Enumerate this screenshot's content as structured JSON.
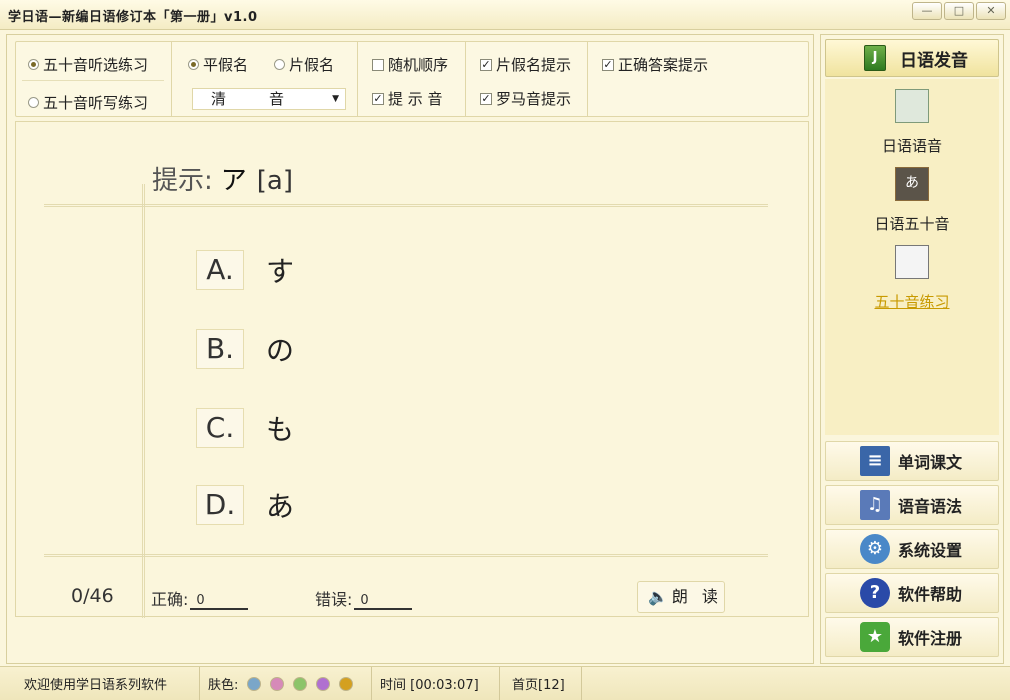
{
  "window": {
    "title": "学日语—新编日语修订本「第一册」v1.0"
  },
  "options": {
    "mode_choice": "五十音听选练习",
    "mode_write": "五十音听写练习",
    "hiragana": "平假名",
    "katakana": "片假名",
    "sound_type": "清　音",
    "random_order": "随机顺序",
    "hint_sound": "提 示 音",
    "katakana_hint": "片假名提示",
    "romaji_hint": "罗马音提示",
    "answer_hint": "正确答案提示"
  },
  "practice": {
    "hint_label": "提示:",
    "hint_kana": "ア",
    "hint_romaji": "[a]",
    "choices": [
      {
        "label": "A.",
        "answer": "す"
      },
      {
        "label": "B.",
        "answer": "の"
      },
      {
        "label": "C.",
        "answer": "も"
      },
      {
        "label": "D.",
        "answer": "あ"
      }
    ],
    "progress": "0/46",
    "correct_label": "正确:",
    "correct_value": "0",
    "wrong_label": "错误:",
    "wrong_value": "0",
    "read_button": "朗读"
  },
  "sidebar": {
    "header": "日语发音",
    "items": [
      {
        "label": "日语语音",
        "icon": "notebook-icon"
      },
      {
        "label": "日语五十音",
        "icon": "chalkboard-icon"
      },
      {
        "label": "五十音练习",
        "icon": "worksheet-icon"
      }
    ],
    "buttons": [
      {
        "label": "单词课文",
        "icon": "books-icon"
      },
      {
        "label": "语音语法",
        "icon": "music-icon"
      },
      {
        "label": "系统设置",
        "icon": "gears-icon"
      },
      {
        "label": "软件帮助",
        "icon": "help-icon"
      },
      {
        "label": "软件注册",
        "icon": "register-icon"
      }
    ]
  },
  "status": {
    "welcome": "欢迎使用学日语系列软件",
    "skin_label": "肤色:",
    "skin_colors": [
      "#7aa6c8",
      "#d68ab8",
      "#8cc46a",
      "#b070d0",
      "#d4a020"
    ],
    "time": "时间 [00:03:07]",
    "page": "首页[12]"
  }
}
